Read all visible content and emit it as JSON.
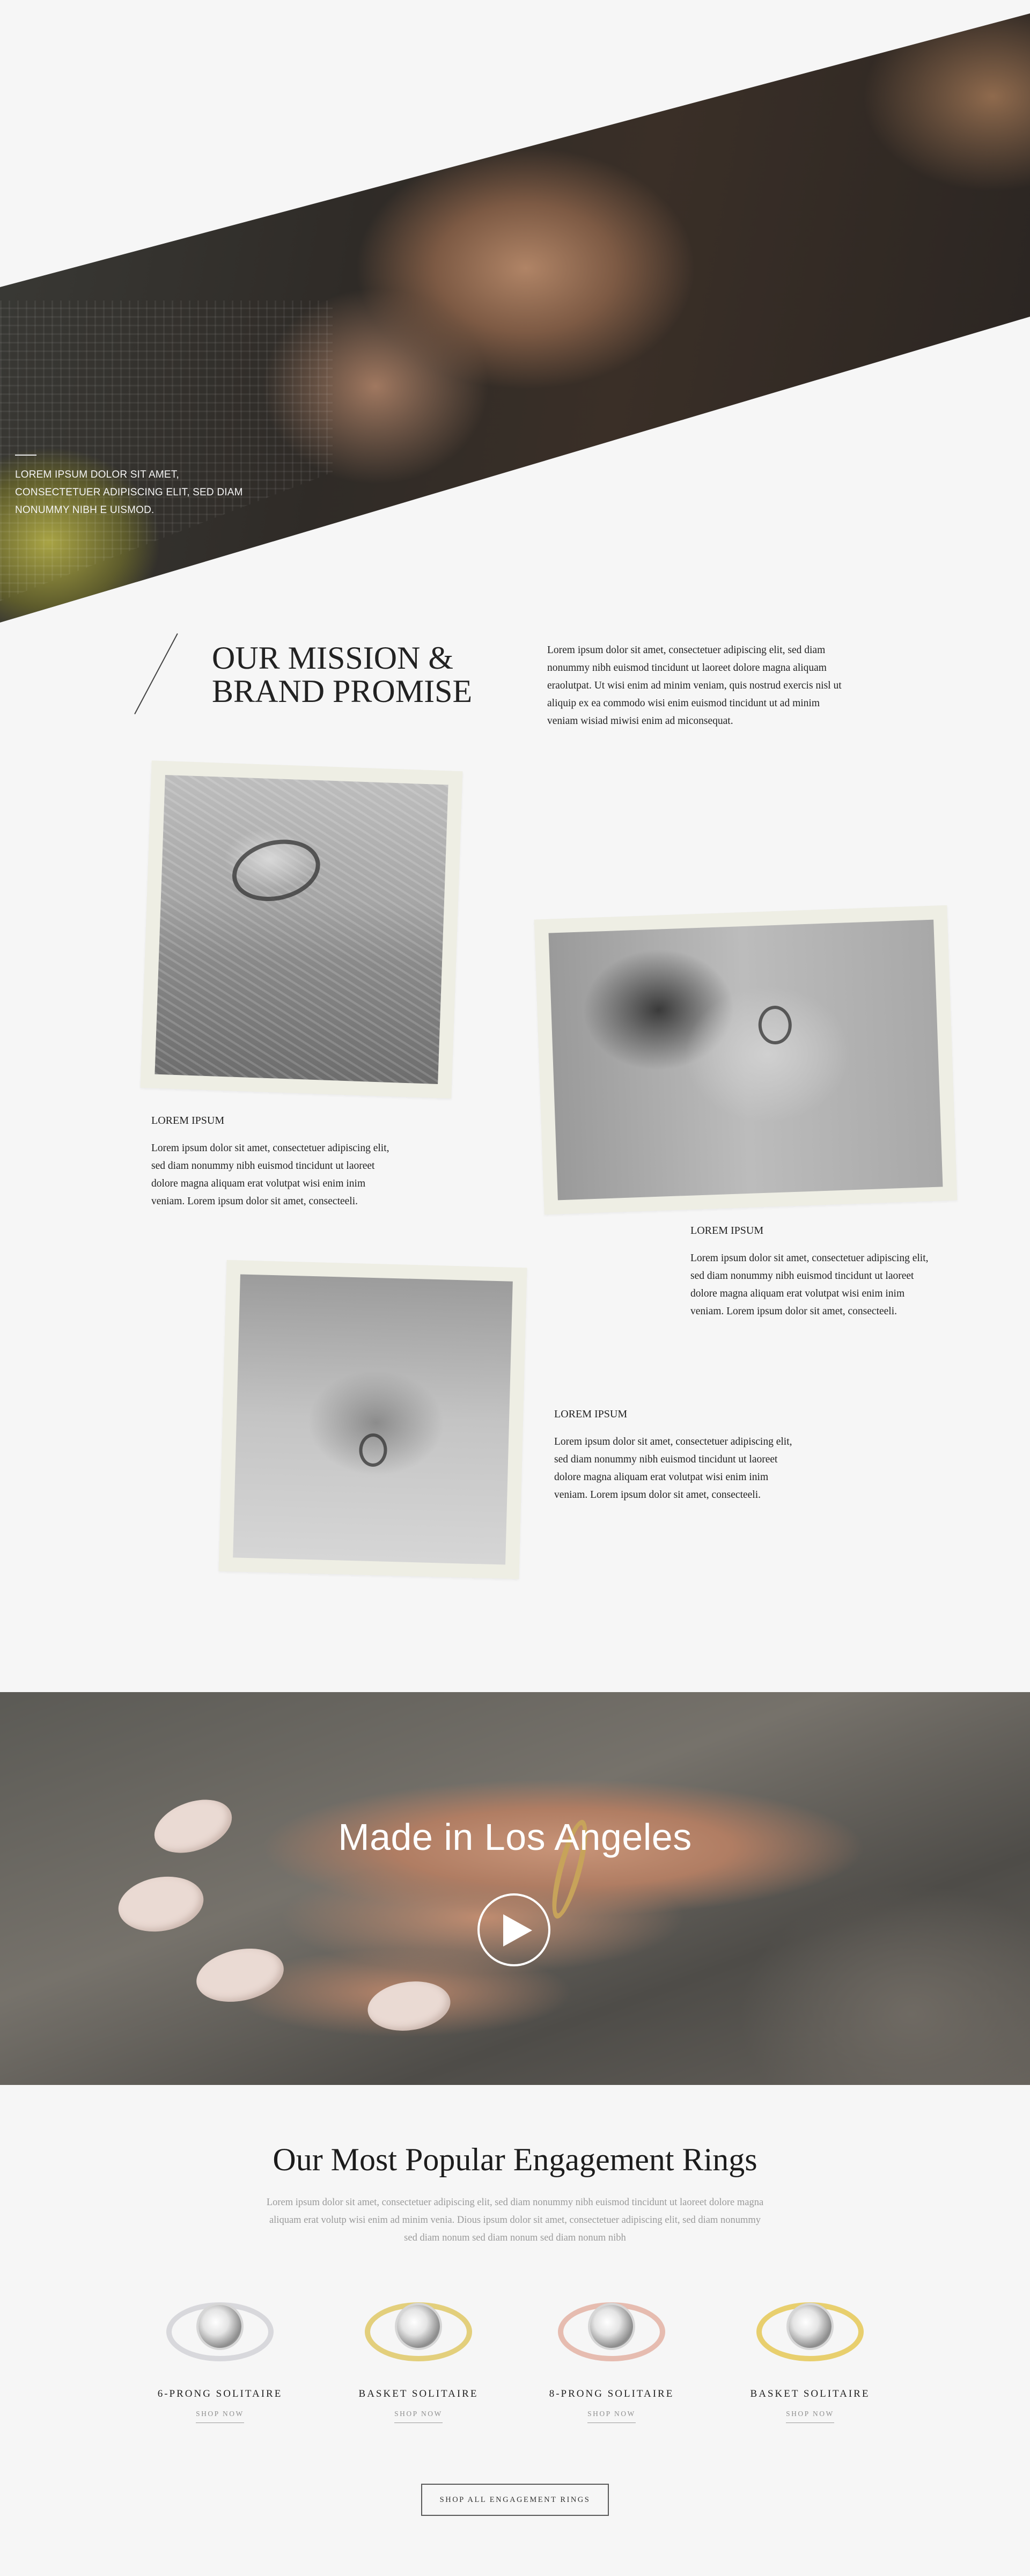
{
  "hero": {
    "caption": "LOREM IPSUM DOLOR SIT AMET, CONSECTETUER ADIPISCING ELIT, SED DIAM NONUMMY NIBH E UISMOD."
  },
  "mission": {
    "title_line1": "OUR MISSION &",
    "title_line2": "BRAND PROMISE",
    "text": "Lorem ipsum dolor sit amet, consectetuer adipiscing elit, sed diam nonummy nibh euismod tincidunt ut laoreet dolore magna aliquam eraolutpat. Ut wisi enim ad minim veniam, quis nostrud exercis nisl ut aliquip ex ea commodo wisi enim euismod tincidunt ut ad minim veniam wisiad miwisi enim ad miconsequat."
  },
  "features": [
    {
      "title": "LOREM IPSUM",
      "text": "Lorem ipsum dolor sit amet, consectetuer adipiscing elit, sed diam nonummy nibh euismod tincidunt ut laoreet dolore magna aliquam erat volutpat  wisi enim inim veniam. Lorem ipsum dolor sit amet, consecteeli."
    },
    {
      "title": "LOREM IPSUM",
      "text": "Lorem ipsum dolor sit amet, consectetuer adipiscing elit, sed diam nonummy nibh euismod tincidunt ut laoreet dolore magna aliquam erat volutpat  wisi enim inim veniam. Lorem ipsum dolor sit amet, consecteeli."
    },
    {
      "title": "LOREM IPSUM",
      "text": "Lorem ipsum dolor sit amet, consectetuer adipiscing elit, sed diam nonummy nibh euismod tincidunt ut laoreet dolore magna aliquam erat volutpat  wisi enim inim veniam. Lorem ipsum dolor sit amet, consecteeli."
    }
  ],
  "video": {
    "title": "Made in Los Angeles",
    "play_icon": "play-icon"
  },
  "rings": {
    "heading": "Our Most Popular Engagement Rings",
    "text": "Lorem ipsum dolor sit amet, consectetuer adipiscing elit, sed diam nonummy nibh euismod tincidunt ut laoreet dolore magna aliquam erat volutp wisi enim ad minim venia. Dious ipsum dolor sit amet, consectetuer adipiscing elit, sed diam nonummy sed diam nonum sed diam nonum sed diam nonum nibh",
    "items": [
      {
        "name": "6-PRONG SOLITAIRE",
        "shop": "SHOP NOW",
        "metal_color": "#d8d8dc"
      },
      {
        "name": "BASKET SOLITAIRE",
        "shop": "SHOP NOW",
        "metal_color": "#e3cf7c"
      },
      {
        "name": "8-PRONG SOLITAIRE",
        "shop": "SHOP NOW",
        "metal_color": "#e6bcb0"
      },
      {
        "name": "BASKET SOLITAIRE",
        "shop": "SHOP NOW",
        "metal_color": "#e8cf6e"
      }
    ],
    "shop_all": "SHOP ALL ENGAGEMENT RINGS"
  },
  "colors": {
    "background": "#f6f6f6",
    "photo_frame": "#eeeee4",
    "muted_text": "#9a9a9a"
  }
}
